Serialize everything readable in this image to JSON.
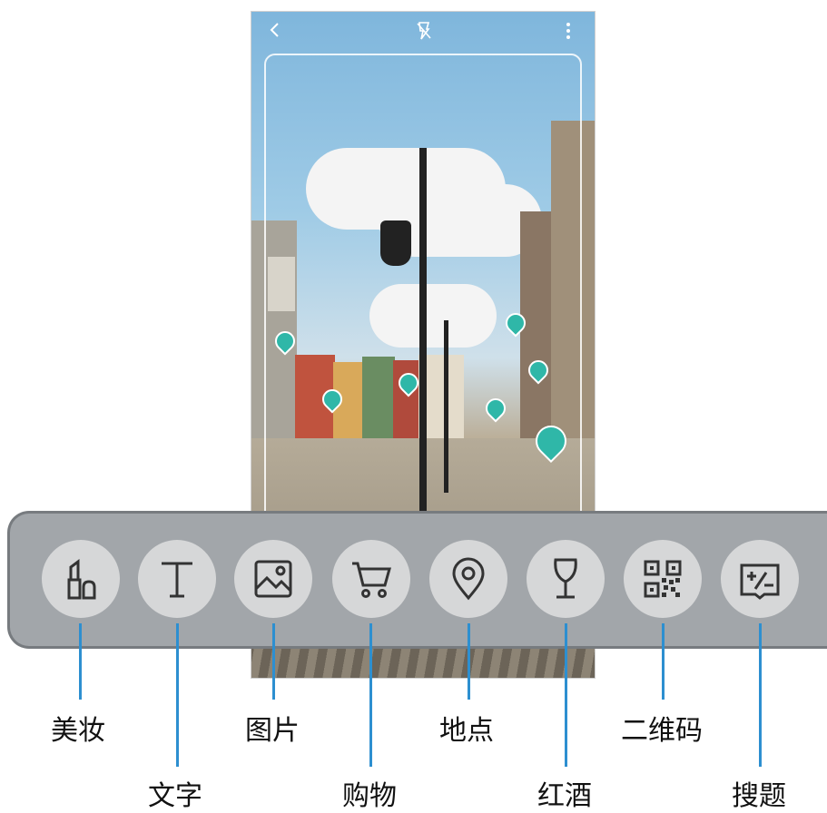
{
  "camera": {
    "icons": [
      "back-icon",
      "flash-icon",
      "more-options-icon"
    ]
  },
  "modes": [
    {
      "id": "makeup",
      "label": "美妆",
      "icon": "lipstick-icon"
    },
    {
      "id": "text",
      "label": "文字",
      "icon": "text-icon"
    },
    {
      "id": "image",
      "label": "图片",
      "icon": "image-icon"
    },
    {
      "id": "shopping",
      "label": "购物",
      "icon": "shopping-cart-icon"
    },
    {
      "id": "place",
      "label": "地点",
      "icon": "location-pin-icon"
    },
    {
      "id": "wine",
      "label": "红酒",
      "icon": "wine-glass-icon"
    },
    {
      "id": "qr",
      "label": "二维码",
      "icon": "qr-code-icon"
    },
    {
      "id": "homework",
      "label": "搜题",
      "icon": "math-book-icon"
    }
  ],
  "colors": {
    "leader": "#2d8fd0",
    "toolbar": "#a2a6aa",
    "pin": "#2fb7a8"
  }
}
